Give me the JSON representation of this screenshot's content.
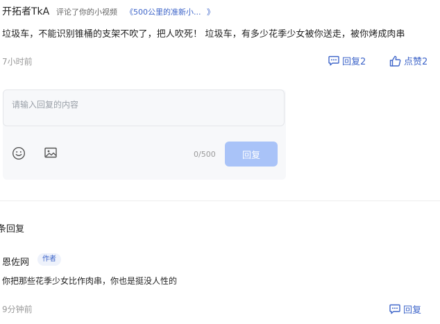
{
  "comment": {
    "author": "开拓者TkA",
    "action": "评论了你的小视频",
    "video_title": "《500公里的准新小...",
    "video_chevron": "》",
    "text": "垃圾车，不能识别锥桶的支架不吹了，把人吹死！ 垃圾车，有多少花季少女被你送走，被你烤成肉串",
    "time": "7小时前",
    "reply_label": "回复2",
    "like_label": "点赞2",
    "icons": {
      "reply": "comment-icon",
      "like": "thumbs-up-icon"
    }
  },
  "reply_box": {
    "placeholder": "请输入回复的内容",
    "char_count": "0/500",
    "submit_label": "回复",
    "icons": {
      "emoji": "emoji-smile-icon",
      "image": "image-icon"
    }
  },
  "replies_section": {
    "count_label": "条回复"
  },
  "reply": {
    "author": "恩佐网",
    "badge": "作者",
    "text": "你把那些花季少女比作肉串，你也是挺没人性的",
    "time": "9分钟前",
    "reply_label": "回复"
  },
  "colors": {
    "accent": "#3e65c9",
    "submit_disabled": "#a9c3f8",
    "muted_text": "#999999",
    "input_bg": "#f7f8fa"
  }
}
